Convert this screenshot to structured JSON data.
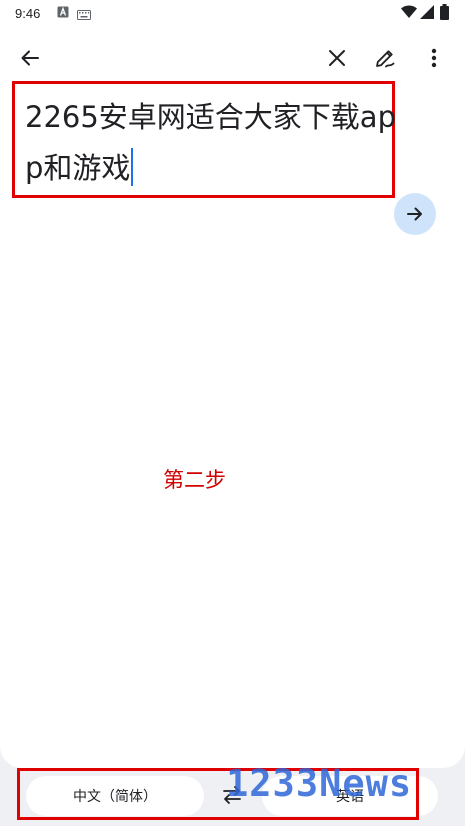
{
  "status_bar": {
    "time": "9:46",
    "left_icons": [
      "a-icon",
      "keyboard-icon"
    ],
    "right_icons": [
      "wifi-icon",
      "signal-icon",
      "battery-icon"
    ]
  },
  "toolbar": {
    "back_icon": "arrow-back-icon",
    "clear_icon": "close-icon",
    "handwriting_icon": "pen-icon",
    "menu_icon": "more-vert-icon"
  },
  "input": {
    "text": "2265安卓网适合大家下载app和游戏"
  },
  "translate_button": {
    "icon": "arrow-forward-icon"
  },
  "annotation": {
    "label": "第二步"
  },
  "language_bar": {
    "source_language": "中文（简体）",
    "target_language": "英语",
    "swap_icon": "swap-arrows-icon"
  },
  "watermark": {
    "text": "1233News"
  },
  "colors": {
    "highlight_red": "#e00000",
    "accent_blue": "#1a73e8",
    "button_blue_bg": "#cfe4fb"
  }
}
